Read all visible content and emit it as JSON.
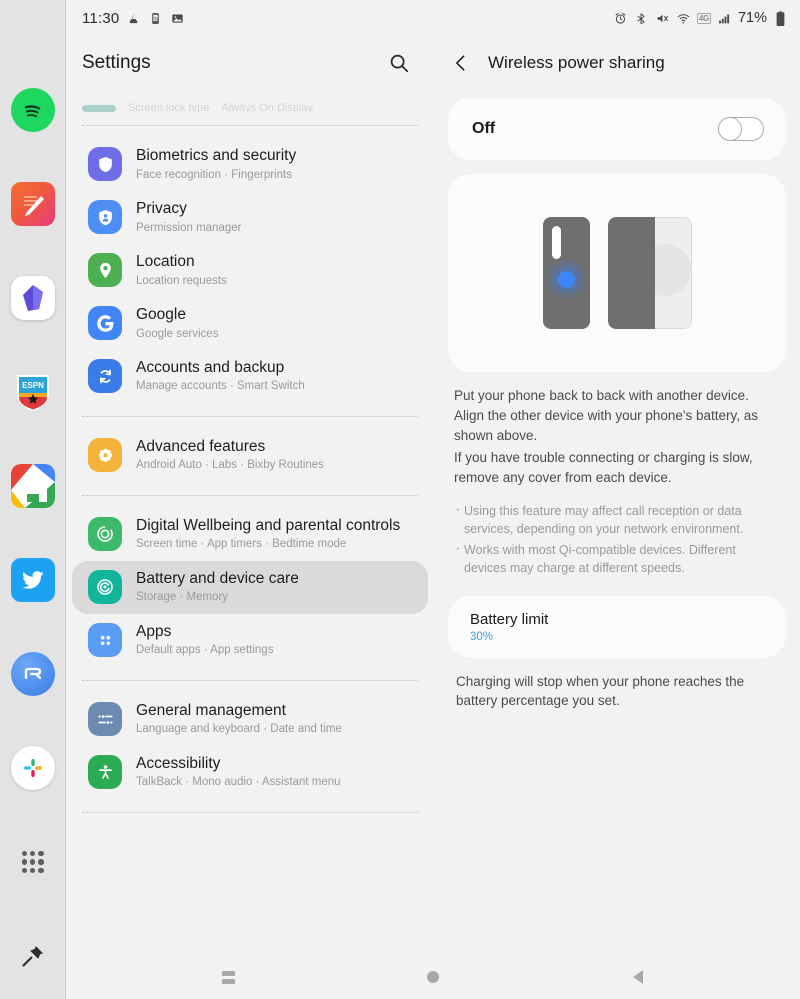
{
  "statusbar": {
    "time": "11:30",
    "left_icons": [
      "vibrate-icon",
      "smart-view-icon",
      "gallery-icon"
    ],
    "right_icons": [
      "alarm-icon",
      "bluetooth-icon",
      "mute-icon",
      "wifi-icon",
      "network-4g-icon",
      "signal-icon"
    ],
    "network_label": "4G",
    "battery_percent": "71%"
  },
  "dock": {
    "items": [
      {
        "name": "spotify",
        "label": "Spotify"
      },
      {
        "name": "notes",
        "label": "Samsung Notes"
      },
      {
        "name": "purple-app",
        "label": "Purple app"
      },
      {
        "name": "espn",
        "label": "ESPN"
      },
      {
        "name": "google-home",
        "label": "Google Home"
      },
      {
        "name": "twitter",
        "label": "Twitter"
      },
      {
        "name": "r-app",
        "label": "R app"
      },
      {
        "name": "slack",
        "label": "Slack"
      },
      {
        "name": "apps-grid",
        "label": "Apps"
      },
      {
        "name": "pin",
        "label": "Pin"
      }
    ]
  },
  "left": {
    "title": "Settings",
    "search_icon": "search-icon",
    "cut_item": {
      "label": "Screen lock type",
      "sub": "Always On Display"
    },
    "items": [
      {
        "icon": "shield-icon",
        "label": "Biometrics and security",
        "sub": "Face recognition  ·  Fingerprints",
        "selected": false
      },
      {
        "icon": "privacy-shield-icon",
        "label": "Privacy",
        "sub": "Permission manager",
        "selected": false
      },
      {
        "icon": "location-pin-icon",
        "label": "Location",
        "sub": "Location requests",
        "selected": false
      },
      {
        "icon": "google-g-icon",
        "label": "Google",
        "sub": "Google services",
        "selected": false
      },
      {
        "icon": "sync-icon",
        "label": "Accounts and backup",
        "sub": "Manage accounts  ·  Smart Switch",
        "selected": false
      },
      {
        "icon": "gear-flower-icon",
        "label": "Advanced features",
        "sub": "Android Auto  ·  Labs  ·  Bixby Routines",
        "selected": false
      },
      {
        "icon": "wellbeing-icon",
        "label": "Digital Wellbeing and parental controls",
        "sub": "Screen time  ·  App timers  ·  Bedtime mode",
        "selected": false
      },
      {
        "icon": "battery-care-icon",
        "label": "Battery and device care",
        "sub": "Storage  ·  Memory",
        "selected": true
      },
      {
        "icon": "apps-dots-icon",
        "label": "Apps",
        "sub": "Default apps  ·  App settings",
        "selected": false
      },
      {
        "icon": "sliders-icon",
        "label": "General management",
        "sub": "Language and keyboard  ·  Date and time",
        "selected": false
      },
      {
        "icon": "accessibility-icon",
        "label": "Accessibility",
        "sub": "TalkBack  ·  Mono audio  ·  Assistant menu",
        "selected": false
      }
    ]
  },
  "right": {
    "back_icon": "chevron-left-icon",
    "title": "Wireless power sharing",
    "toggle": {
      "state_label": "Off",
      "checked": false
    },
    "illustration": {
      "name": "two-phones-back-to-back",
      "phone_left": "standard-phone",
      "phone_right": "foldable-phone"
    },
    "description": [
      "Put your phone back to back with another device. Align the other device with your phone's battery, as shown above.",
      "If you have trouble connecting or charging is slow, remove any cover from each device."
    ],
    "bullets": [
      "Using this feature may affect call reception or data services, depending on your network environment.",
      "Works with most Qi-compatible devices. Different devices may charge at different speeds."
    ],
    "battery_limit": {
      "label": "Battery limit",
      "value": "30%",
      "value_color": "#4a9ae0",
      "note": "Charging will stop when your phone reaches the battery percentage you set."
    }
  },
  "navbar": {
    "recents_icon": "recents-icon",
    "home_icon": "home-icon",
    "back_icon": "back-icon"
  },
  "annotation": {
    "shape": "ellipse",
    "color": "#d81f16",
    "target": "wireless-power-sharing-toggle-card"
  }
}
